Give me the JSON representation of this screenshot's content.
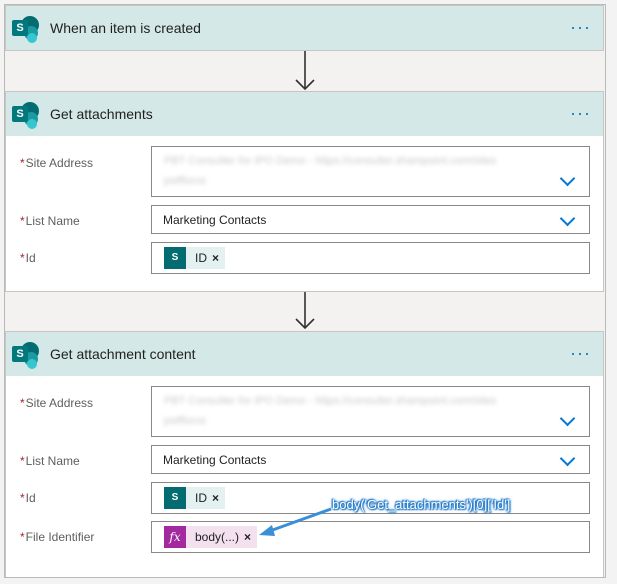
{
  "steps": [
    {
      "title": "When an item is created",
      "more": "···"
    },
    {
      "title": "Get attachments",
      "more": "···",
      "fields": {
        "site_address_label": "Site Address",
        "site_address_value_line1": "PBT Consulter for IPO Demo - https://consulter.sharepoint.com/sites",
        "site_address_value_line2": "pstfforce",
        "list_name_label": "List Name",
        "list_name_value": "Marketing Contacts",
        "id_label": "Id",
        "id_token": "ID",
        "token_remove": "×"
      }
    },
    {
      "title": "Get attachment content",
      "more": "···",
      "fields": {
        "site_address_label": "Site Address",
        "site_address_value_line1": "PBT Consulter for IPO Demo - https://consulter.sharepoint.com/sites",
        "site_address_value_line2": "pstfforce",
        "list_name_label": "List Name",
        "list_name_value": "Marketing Contacts",
        "id_label": "Id",
        "id_token": "ID",
        "file_identifier_label": "File Identifier",
        "file_identifier_token": "body(...)",
        "token_remove": "×"
      }
    }
  ],
  "required_marker": "*",
  "sharepoint_glyph": "S",
  "fx_glyph": "fx",
  "annotation": "body('Get_attachments')[0]['Id']",
  "colors": {
    "header_bg": "#d5e8e8",
    "accent_blue": "#0078d4",
    "sharepoint_teal": "#036c70",
    "expression_purple": "#a3299e",
    "required_red": "#a4262c"
  },
  "icons": [
    "sharepoint-icon",
    "more-options-icon",
    "chevron-down-icon",
    "down-arrow-icon",
    "expression-fx-icon",
    "remove-token-icon"
  ]
}
